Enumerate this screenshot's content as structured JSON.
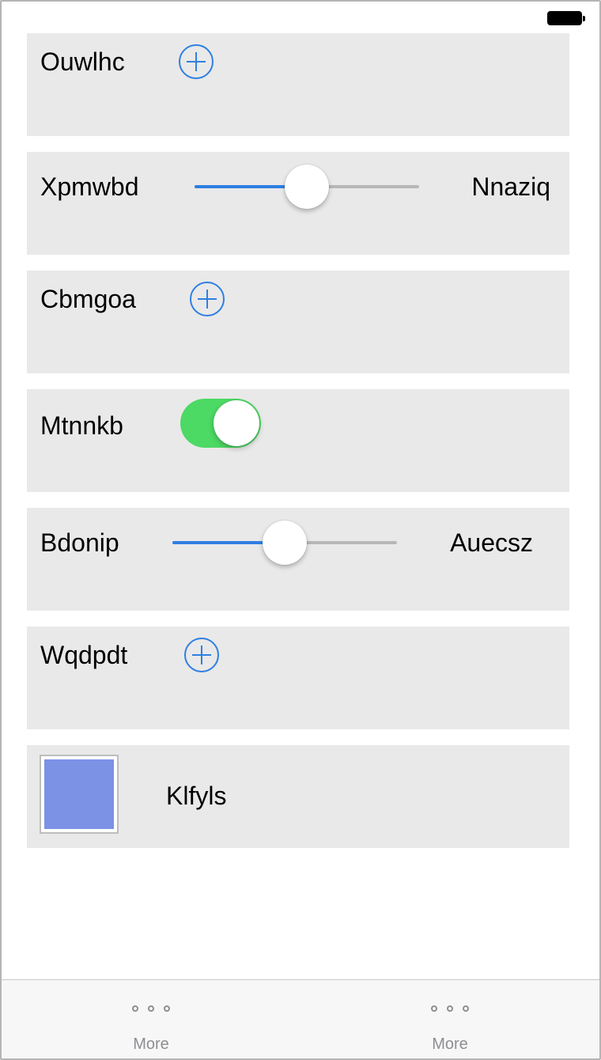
{
  "rows": [
    {
      "type": "add",
      "label": "Ouwlhc",
      "icon": "plus-circle-icon"
    },
    {
      "type": "slider",
      "min_label": "Xpmwbd",
      "max_label": "Nnaziq",
      "value": 0.5
    },
    {
      "type": "add",
      "label": "Cbmgoa",
      "icon": "plus-circle-icon"
    },
    {
      "type": "toggle",
      "label": "Mtnnkb",
      "on": true
    },
    {
      "type": "slider",
      "min_label": "Bdonip",
      "max_label": "Auecsz",
      "value": 0.5
    },
    {
      "type": "add",
      "label": "Wqdpdt",
      "icon": "plus-circle-icon"
    },
    {
      "type": "color",
      "label": "Klfyls",
      "color": "#7b92e5"
    }
  ],
  "tabbar": {
    "tabs": [
      {
        "label": "More",
        "icon": "more-icon"
      },
      {
        "label": "More",
        "icon": "more-icon"
      }
    ]
  },
  "colors": {
    "accent": "#2f7fe2",
    "toggle_on": "#4cd964",
    "card_bg": "#e9e9e9"
  }
}
